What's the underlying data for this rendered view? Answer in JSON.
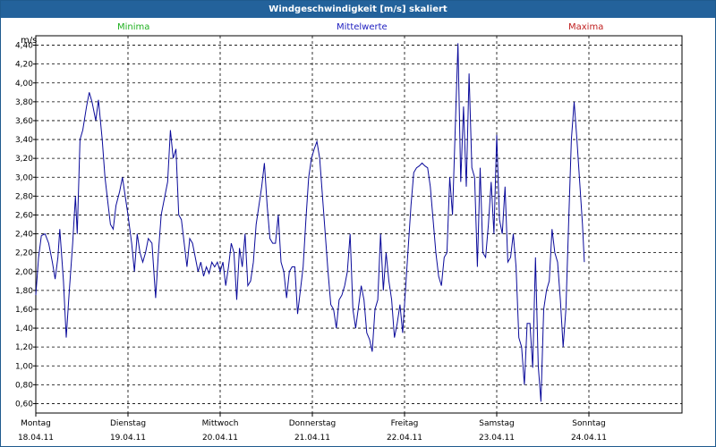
{
  "title": "Windgeschwindigkeit [m/s] skaliert",
  "legend": {
    "min": "Minima",
    "mean": "Mittelwerte",
    "max": "Maxima"
  },
  "colors": {
    "min": "#1fb01f",
    "mean": "#2020c0",
    "max": "#c02020",
    "line": "#0a0a9a",
    "titlebar": "#23629b"
  },
  "chart_data": {
    "type": "line",
    "ylabel": "m/s",
    "ylim": [
      0.5,
      4.5
    ],
    "yticks": [
      "4,40",
      "4,20",
      "4,00",
      "3,80",
      "3,60",
      "3,40",
      "3,20",
      "3,00",
      "2,80",
      "2,60",
      "2,40",
      "2,20",
      "2,00",
      "1,80",
      "1,60",
      "1,40",
      "1,20",
      "1,00",
      "0,80",
      "0,60"
    ],
    "ytick_values": [
      4.4,
      4.2,
      4.0,
      3.8,
      3.6,
      3.4,
      3.2,
      3.0,
      2.8,
      2.6,
      2.4,
      2.2,
      2.0,
      1.8,
      1.6,
      1.4,
      1.2,
      1.0,
      0.8,
      0.6
    ],
    "xticks": [
      {
        "day": "Montag",
        "date": "18.04.11"
      },
      {
        "day": "Dienstag",
        "date": "19.04.11"
      },
      {
        "day": "Mittwoch",
        "date": "20.04.11"
      },
      {
        "day": "Donnerstag",
        "date": "21.04.11"
      },
      {
        "day": "Freitag",
        "date": "22.04.11"
      },
      {
        "day": "Samstag",
        "date": "23.04.11"
      },
      {
        "day": "Sonntag",
        "date": "24.04.11"
      }
    ],
    "xlim": [
      0,
      7
    ],
    "grid": true,
    "series": [
      {
        "values": [
          [
            0.0,
            1.75
          ],
          [
            0.03,
            2.15
          ],
          [
            0.06,
            2.38
          ],
          [
            0.1,
            2.4
          ],
          [
            0.14,
            2.3
          ],
          [
            0.18,
            2.1
          ],
          [
            0.21,
            1.92
          ],
          [
            0.24,
            2.15
          ],
          [
            0.26,
            2.45
          ],
          [
            0.3,
            1.9
          ],
          [
            0.33,
            1.3
          ],
          [
            0.36,
            1.75
          ],
          [
            0.4,
            2.3
          ],
          [
            0.43,
            2.8
          ],
          [
            0.45,
            2.4
          ],
          [
            0.48,
            3.4
          ],
          [
            0.51,
            3.5
          ],
          [
            0.55,
            3.75
          ],
          [
            0.58,
            3.9
          ],
          [
            0.61,
            3.8
          ],
          [
            0.65,
            3.6
          ],
          [
            0.68,
            3.82
          ],
          [
            0.72,
            3.4
          ],
          [
            0.75,
            3.0
          ],
          [
            0.78,
            2.75
          ],
          [
            0.81,
            2.5
          ],
          [
            0.84,
            2.45
          ],
          [
            0.87,
            2.7
          ],
          [
            0.91,
            2.85
          ],
          [
            0.94,
            3.0
          ],
          [
            0.97,
            2.8
          ],
          [
            1.0,
            2.6
          ],
          [
            1.04,
            2.3
          ],
          [
            1.07,
            2.0
          ],
          [
            1.1,
            2.4
          ],
          [
            1.13,
            2.2
          ],
          [
            1.16,
            2.1
          ],
          [
            1.19,
            2.2
          ],
          [
            1.22,
            2.35
          ],
          [
            1.26,
            2.3
          ],
          [
            1.3,
            1.72
          ],
          [
            1.33,
            2.2
          ],
          [
            1.36,
            2.6
          ],
          [
            1.4,
            2.8
          ],
          [
            1.43,
            2.95
          ],
          [
            1.46,
            3.5
          ],
          [
            1.49,
            3.2
          ],
          [
            1.52,
            3.3
          ],
          [
            1.55,
            2.6
          ],
          [
            1.58,
            2.55
          ],
          [
            1.61,
            2.3
          ],
          [
            1.64,
            2.05
          ],
          [
            1.67,
            2.35
          ],
          [
            1.7,
            2.3
          ],
          [
            1.73,
            2.15
          ],
          [
            1.76,
            2.0
          ],
          [
            1.79,
            2.1
          ],
          [
            1.82,
            1.95
          ],
          [
            1.85,
            2.05
          ],
          [
            1.88,
            1.98
          ],
          [
            1.91,
            2.1
          ],
          [
            1.94,
            2.05
          ],
          [
            1.97,
            2.1
          ],
          [
            2.0,
            2.0
          ],
          [
            2.03,
            2.1
          ],
          [
            2.06,
            1.85
          ],
          [
            2.09,
            2.05
          ],
          [
            2.12,
            2.3
          ],
          [
            2.15,
            2.2
          ],
          [
            2.18,
            1.7
          ],
          [
            2.21,
            2.25
          ],
          [
            2.24,
            2.05
          ],
          [
            2.27,
            2.4
          ],
          [
            2.3,
            1.85
          ],
          [
            2.33,
            1.9
          ],
          [
            2.36,
            2.1
          ],
          [
            2.39,
            2.5
          ],
          [
            2.42,
            2.7
          ],
          [
            2.45,
            2.9
          ],
          [
            2.48,
            3.15
          ],
          [
            2.51,
            2.7
          ],
          [
            2.54,
            2.35
          ],
          [
            2.57,
            2.3
          ],
          [
            2.6,
            2.3
          ],
          [
            2.63,
            2.6
          ],
          [
            2.66,
            2.1
          ],
          [
            2.69,
            2.0
          ],
          [
            2.72,
            1.72
          ],
          [
            2.75,
            2.0
          ],
          [
            2.78,
            2.05
          ],
          [
            2.81,
            2.05
          ],
          [
            2.84,
            1.55
          ],
          [
            2.87,
            1.8
          ],
          [
            2.9,
            2.05
          ],
          [
            2.93,
            2.55
          ],
          [
            2.96,
            3.0
          ],
          [
            2.99,
            3.2
          ],
          [
            3.02,
            3.3
          ],
          [
            3.05,
            3.38
          ],
          [
            3.08,
            3.2
          ],
          [
            3.11,
            2.8
          ],
          [
            3.14,
            2.4
          ],
          [
            3.17,
            2.0
          ],
          [
            3.2,
            1.65
          ],
          [
            3.23,
            1.6
          ],
          [
            3.26,
            1.4
          ],
          [
            3.29,
            1.7
          ],
          [
            3.32,
            1.75
          ],
          [
            3.35,
            1.85
          ],
          [
            3.38,
            2.0
          ],
          [
            3.41,
            2.4
          ],
          [
            3.44,
            1.6
          ],
          [
            3.47,
            1.4
          ],
          [
            3.5,
            1.62
          ],
          [
            3.53,
            1.85
          ],
          [
            3.56,
            1.7
          ],
          [
            3.59,
            1.35
          ],
          [
            3.62,
            1.28
          ],
          [
            3.65,
            1.15
          ],
          [
            3.68,
            1.6
          ],
          [
            3.71,
            1.7
          ],
          [
            3.74,
            2.4
          ],
          [
            3.77,
            1.8
          ],
          [
            3.8,
            2.2
          ],
          [
            3.83,
            1.9
          ],
          [
            3.86,
            1.7
          ],
          [
            3.89,
            1.3
          ],
          [
            3.92,
            1.45
          ],
          [
            3.95,
            1.65
          ],
          [
            3.98,
            1.35
          ],
          [
            4.01,
            1.8
          ],
          [
            4.04,
            2.25
          ],
          [
            4.07,
            2.7
          ],
          [
            4.1,
            3.05
          ],
          [
            4.13,
            3.1
          ],
          [
            4.16,
            3.12
          ],
          [
            4.19,
            3.15
          ],
          [
            4.22,
            3.12
          ],
          [
            4.25,
            3.1
          ],
          [
            4.28,
            2.9
          ],
          [
            4.31,
            2.55
          ],
          [
            4.34,
            2.2
          ],
          [
            4.37,
            1.95
          ],
          [
            4.4,
            1.85
          ],
          [
            4.43,
            2.15
          ],
          [
            4.46,
            2.2
          ],
          [
            4.49,
            3.0
          ],
          [
            4.52,
            2.6
          ],
          [
            4.55,
            3.5
          ],
          [
            4.58,
            4.42
          ],
          [
            4.61,
            2.95
          ],
          [
            4.64,
            3.75
          ],
          [
            4.67,
            2.9
          ],
          [
            4.7,
            4.1
          ],
          [
            4.73,
            3.1
          ],
          [
            4.76,
            3.0
          ],
          [
            4.79,
            2.05
          ],
          [
            4.82,
            3.1
          ],
          [
            4.85,
            2.2
          ],
          [
            4.88,
            2.15
          ],
          [
            4.91,
            2.5
          ],
          [
            4.94,
            2.95
          ],
          [
            4.97,
            2.4
          ],
          [
            5.0,
            3.45
          ],
          [
            5.03,
            2.55
          ],
          [
            5.06,
            2.4
          ],
          [
            5.09,
            2.9
          ],
          [
            5.12,
            2.1
          ],
          [
            5.15,
            2.15
          ],
          [
            5.18,
            2.4
          ],
          [
            5.21,
            2.05
          ],
          [
            5.24,
            1.3
          ],
          [
            5.27,
            1.2
          ],
          [
            5.3,
            0.8
          ],
          [
            5.33,
            1.45
          ],
          [
            5.36,
            1.45
          ],
          [
            5.39,
            0.98
          ],
          [
            5.42,
            2.15
          ],
          [
            5.45,
            1.0
          ],
          [
            5.48,
            0.62
          ],
          [
            5.51,
            1.6
          ],
          [
            5.54,
            1.8
          ],
          [
            5.57,
            1.9
          ],
          [
            5.6,
            2.45
          ],
          [
            5.63,
            2.2
          ],
          [
            5.66,
            2.1
          ],
          [
            5.69,
            1.7
          ],
          [
            5.72,
            1.2
          ],
          [
            5.75,
            1.6
          ],
          [
            5.78,
            2.5
          ],
          [
            5.81,
            3.4
          ],
          [
            5.84,
            3.8
          ],
          [
            5.87,
            3.4
          ],
          [
            5.9,
            2.95
          ],
          [
            5.93,
            2.5
          ],
          [
            5.95,
            2.1
          ]
        ]
      }
    ]
  }
}
